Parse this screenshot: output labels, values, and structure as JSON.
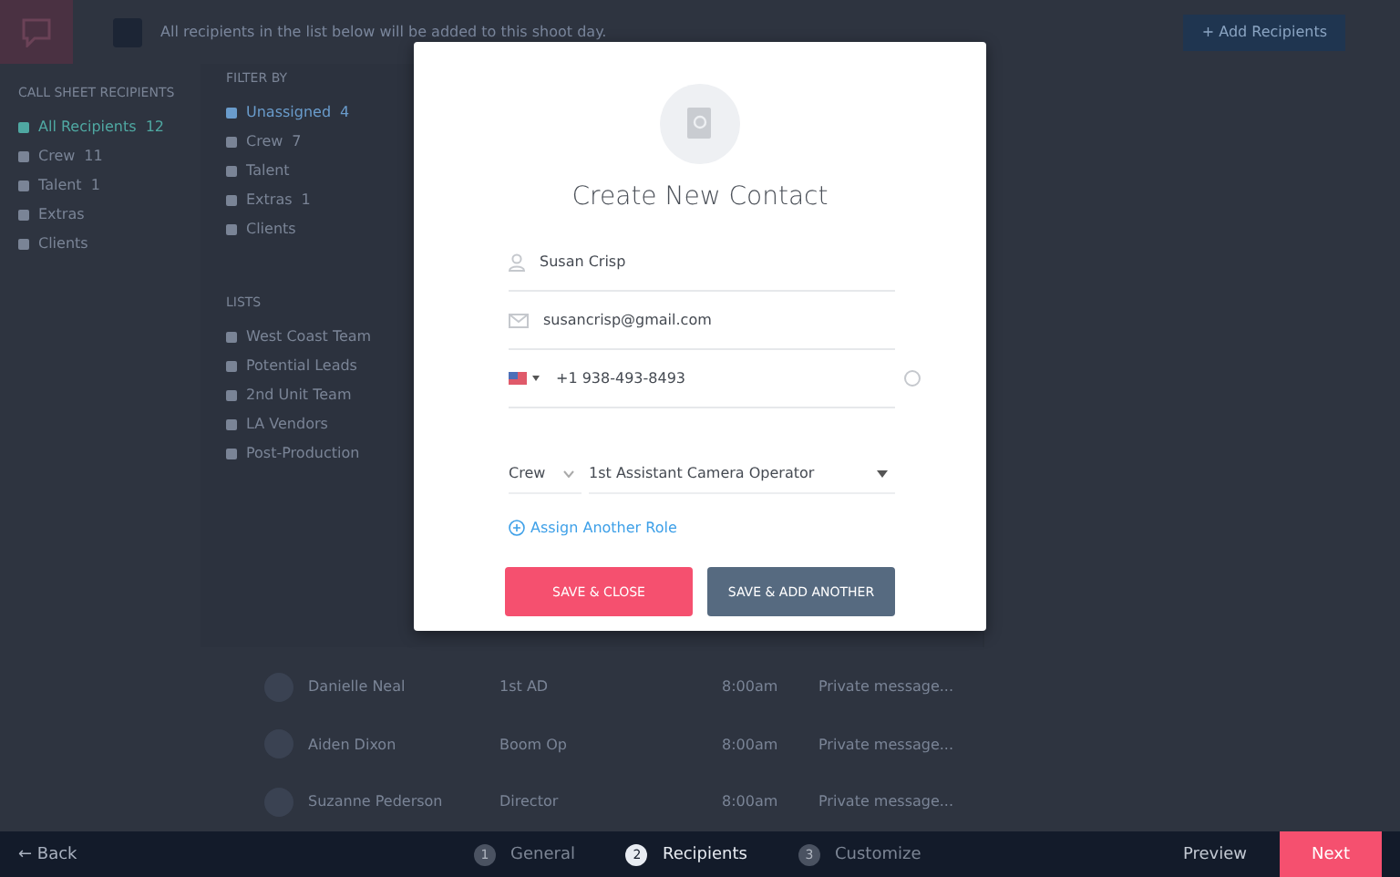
{
  "header": {
    "message": "All recipients in the list below will be added to this shoot day.",
    "add_button": "+ Add Recipients"
  },
  "sidebar": {
    "title": "CALL SHEET RECIPIENTS",
    "items": [
      {
        "label": "All Recipients",
        "count": "12",
        "selected": true
      },
      {
        "label": "Crew",
        "count": "11",
        "selected": false
      },
      {
        "label": "Talent",
        "count": "1",
        "selected": false
      },
      {
        "label": "Extras",
        "selected": false
      },
      {
        "label": "Clients",
        "selected": false
      }
    ]
  },
  "filter": {
    "title": "FILTER BY",
    "items": [
      {
        "label": "Unassigned",
        "count": "4",
        "selected": true
      },
      {
        "label": "Crew",
        "count": "7",
        "selected": false
      },
      {
        "label": "Talent",
        "selected": false
      },
      {
        "label": "Extras",
        "count": "1",
        "selected": false
      },
      {
        "label": "Clients",
        "selected": false
      }
    ],
    "lists_title": "LISTS",
    "lists": [
      "West Coast Team",
      "Potential Leads",
      "2nd Unit Team",
      "LA Vendors",
      "Post-Production"
    ]
  },
  "table": {
    "rows": [
      {
        "name": "Danielle Neal",
        "role": "1st AD",
        "time": "8:00am",
        "message_placeholder": "Private message..."
      },
      {
        "name": "Aiden Dixon",
        "role": "Boom Op",
        "time": "8:00am",
        "message_placeholder": "Private message..."
      },
      {
        "name": "Suzanne Pederson",
        "role": "Director",
        "time": "8:00am",
        "message_placeholder": "Private message..."
      }
    ]
  },
  "modal": {
    "title": "Create New Contact",
    "name": "Susan Crisp",
    "email": "susancrisp@gmail.com",
    "phone": "+1 938-493-8493",
    "department": "Crew",
    "role": "1st Assistant Camera Operator",
    "assign_link": "Assign Another Role",
    "buttons": [
      {
        "label": "SAVE & CLOSE",
        "kind": "primary"
      },
      {
        "label": "SAVE & ADD ANOTHER",
        "kind": "secondary"
      }
    ]
  },
  "footer": {
    "back": "← Back",
    "steps": [
      {
        "number": "1",
        "label": "General",
        "selected": false
      },
      {
        "number": "2",
        "label": "Recipients",
        "selected": true
      },
      {
        "number": "3",
        "label": "Customize",
        "selected": false
      }
    ],
    "preview": "Preview",
    "next": "Next"
  }
}
